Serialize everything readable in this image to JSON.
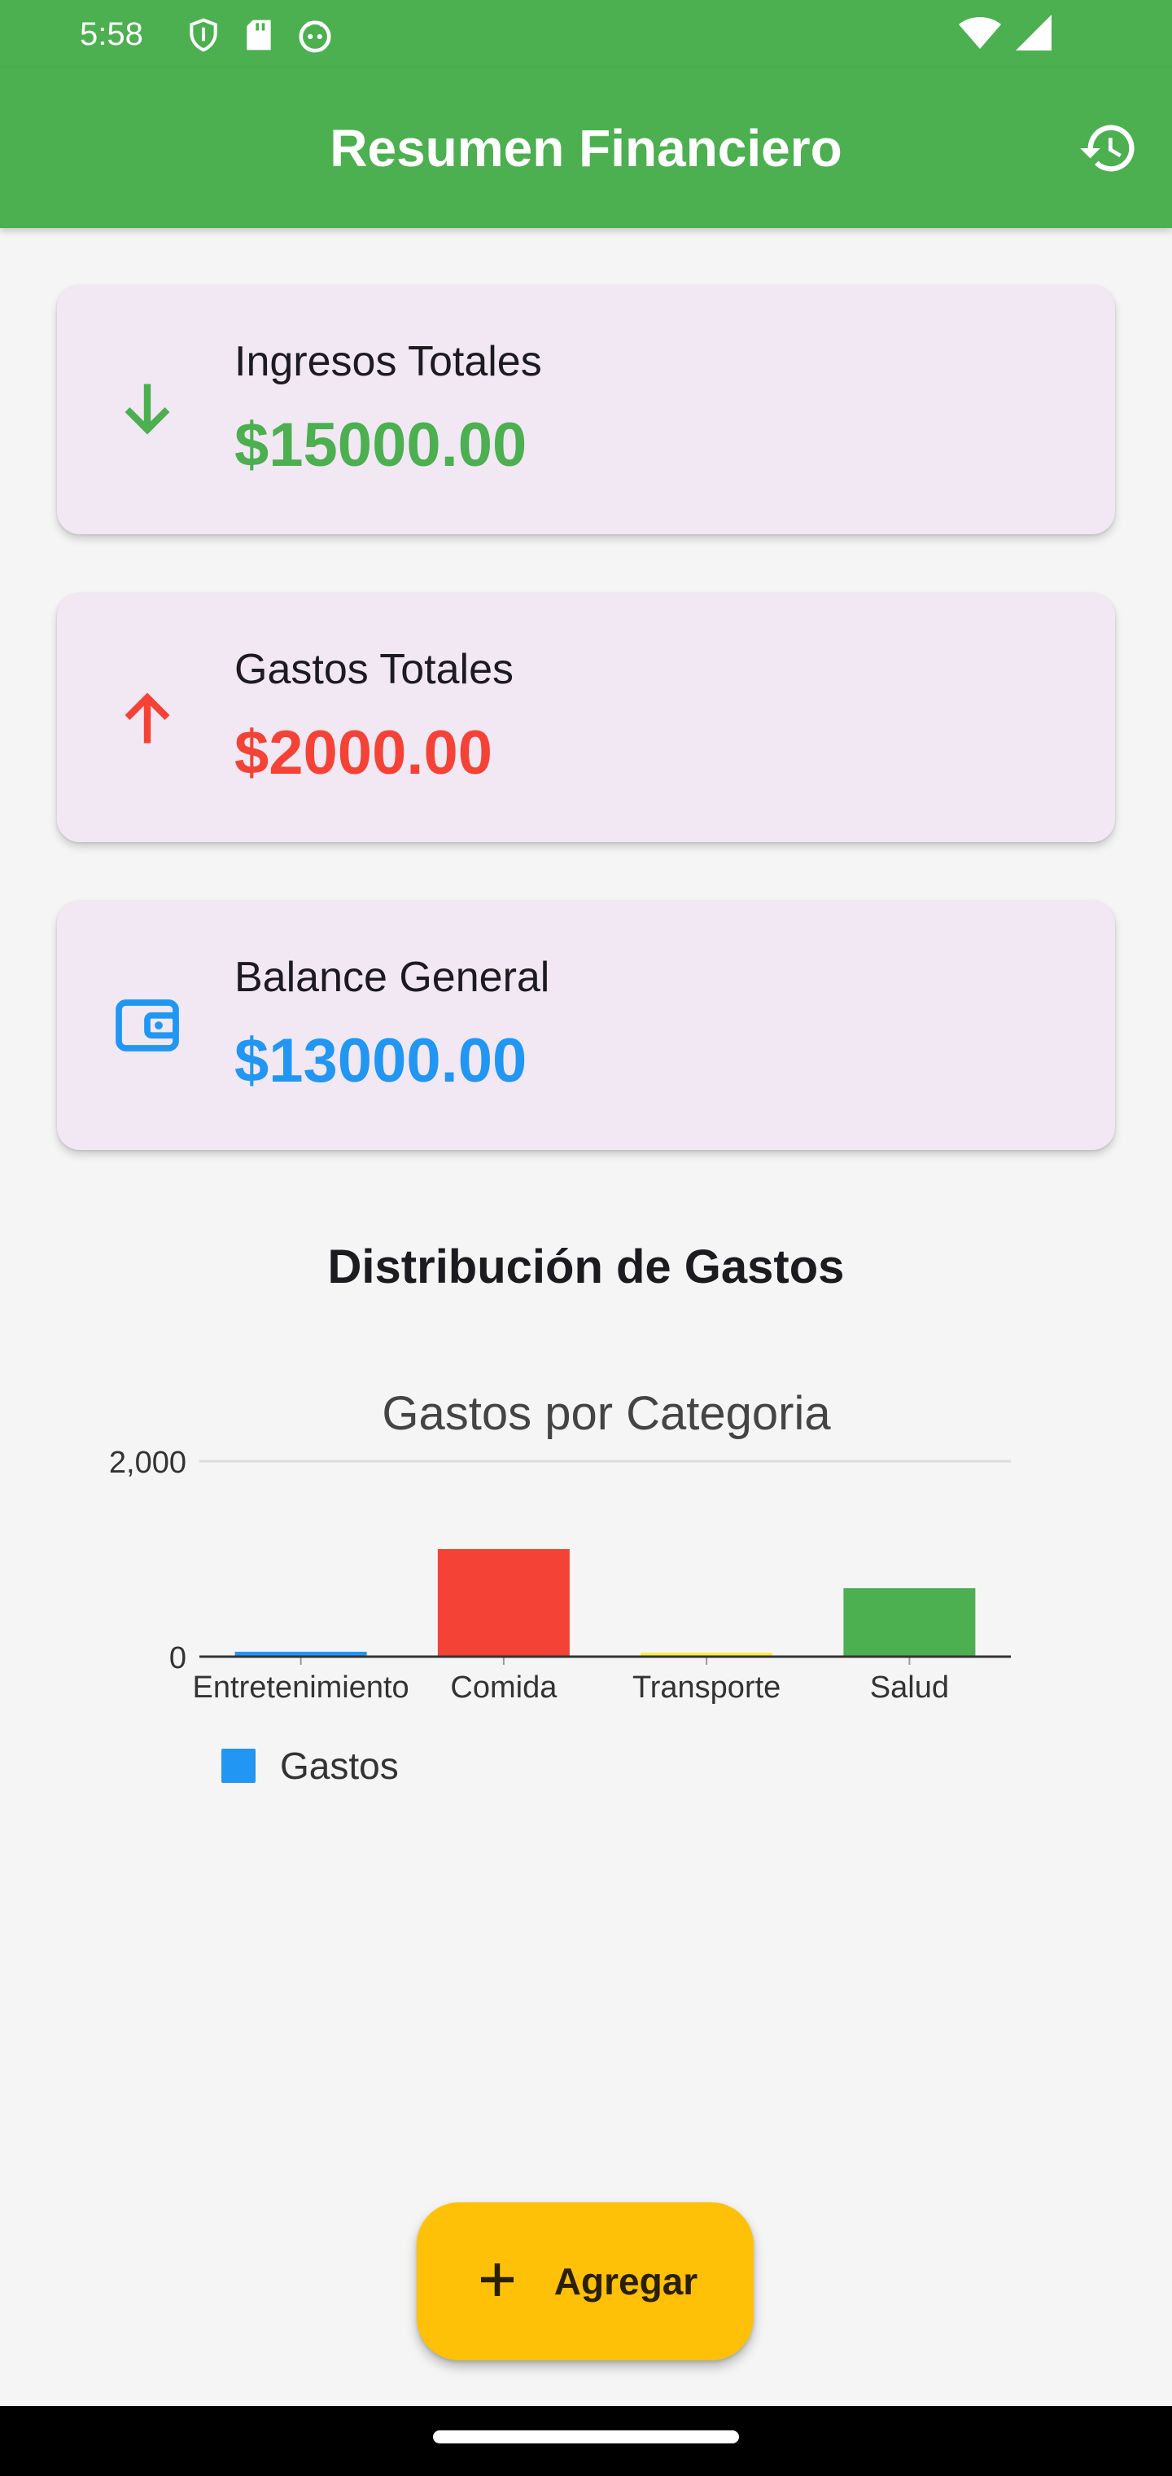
{
  "status_bar": {
    "time": "5:58"
  },
  "app_bar": {
    "title": "Resumen Financiero",
    "action_icon": "history-icon"
  },
  "cards": [
    {
      "label": "Ingresos Totales",
      "value": "$15000.00",
      "icon": "arrow-down-icon",
      "color": "#4caf50"
    },
    {
      "label": "Gastos Totales",
      "value": "$2000.00",
      "icon": "arrow-up-icon",
      "color": "#f44336"
    },
    {
      "label": "Balance General",
      "value": "$13000.00",
      "icon": "wallet-icon",
      "color": "#2196f3"
    }
  ],
  "section_title": "Distribución de Gastos",
  "chart_data": {
    "type": "bar",
    "title": "Gastos por Categoria",
    "xlabel": "",
    "ylabel": "",
    "categories": [
      "Entretenimiento",
      "Comida",
      "Transporte",
      "Salud"
    ],
    "series": [
      {
        "name": "Gastos",
        "values": [
          50,
          1100,
          40,
          700
        ]
      }
    ],
    "bar_colors": [
      "#2196f3",
      "#f44336",
      "#ffeb3b",
      "#4caf50"
    ],
    "ylim": [
      0,
      2000
    ],
    "y_ticks": [
      "0",
      "2,000"
    ],
    "grid": true,
    "legend_placement": "bottom-left"
  },
  "legend": {
    "label": "Gastos",
    "color": "#2196f3"
  },
  "fab": {
    "label": "Agregar",
    "icon": "plus-icon"
  }
}
